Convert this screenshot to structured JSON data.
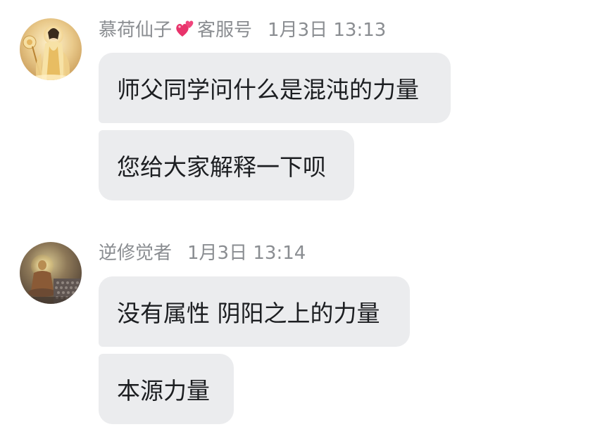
{
  "messages": [
    {
      "sender": "慕荷仙子",
      "sender_suffix": "客服号",
      "sender_emoji": "two-hearts-icon",
      "time": "1月3日 13:13",
      "avatar": "guanyin-avatar",
      "bubbles": [
        "师父同学问什么是混沌的力量",
        "您给大家解释一下呗"
      ]
    },
    {
      "sender": "逆修觉者",
      "sender_suffix": "",
      "time": "1月3日 13:14",
      "avatar": "buddha-avatar",
      "bubbles": [
        "没有属性 阴阳之上的力量",
        "本源力量"
      ]
    }
  ],
  "colors": {
    "bubble_bg": "#ebecee",
    "meta_text": "#8a8d91",
    "message_text": "#1c1e21",
    "heart": "#e8336b"
  }
}
